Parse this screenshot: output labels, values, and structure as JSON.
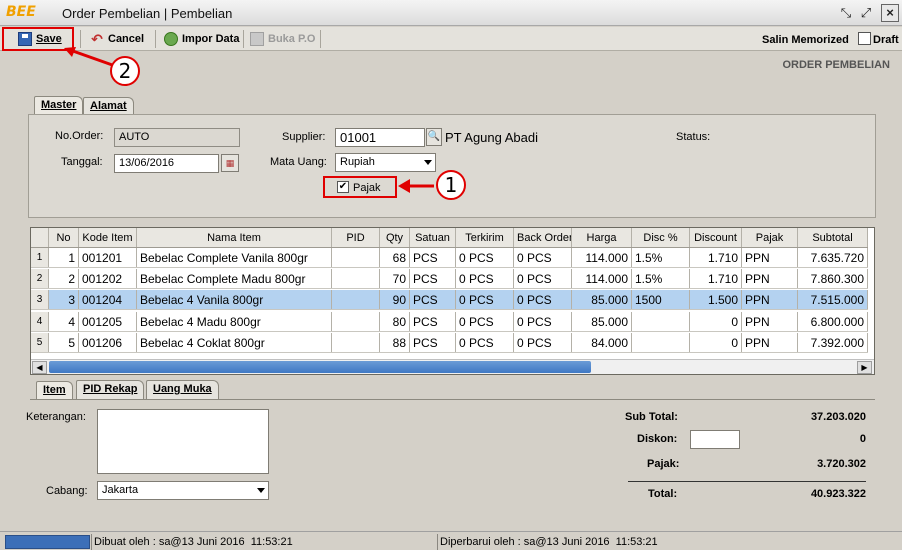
{
  "window": {
    "logo": "BEE",
    "title": "Order Pembelian | Pembelian"
  },
  "toolbar": {
    "save": "Save",
    "cancel": "Cancel",
    "impor": "Impor Data",
    "buka": "Buka P.O",
    "salin": "Salin Memorized",
    "draft": "Draft"
  },
  "callouts": {
    "one": "1",
    "two": "2"
  },
  "page_title": "ORDER PEMBELIAN",
  "tabs_top": {
    "master": "Master",
    "alamat": "Alamat"
  },
  "master": {
    "no_order_label": "No.Order:",
    "no_order_value": "AUTO",
    "tanggal_label": "Tanggal:",
    "tanggal_value": "13/06/2016",
    "supplier_label": "Supplier:",
    "supplier_code": "01001",
    "supplier_name": "PT Agung Abadi",
    "mata_uang_label": "Mata Uang:",
    "mata_uang_value": "Rupiah",
    "status_label": "Status:",
    "pajak_label": "Pajak",
    "pajak_checked": true
  },
  "grid": {
    "columns": [
      "No",
      "Kode Item",
      "Nama Item",
      "PID",
      "Qty",
      "Satuan",
      "Terkirim",
      "Back Order",
      "Harga",
      "Disc %",
      "Discount",
      "Pajak",
      "Subtotal"
    ],
    "rows": [
      {
        "rownum": "1",
        "no": "1",
        "kode": "001201",
        "nama": "Bebelac Complete Vanila 800gr",
        "pid": "",
        "qty": "68",
        "satuan": "PCS",
        "terkirim": "0 PCS",
        "backorder": "0 PCS",
        "harga": "114.000",
        "disc": "1.5%",
        "discount": "1.710",
        "pajak": "PPN",
        "subtotal": "7.635.720"
      },
      {
        "rownum": "2",
        "no": "2",
        "kode": "001202",
        "nama": "Bebelac Complete Madu 800gr",
        "pid": "",
        "qty": "70",
        "satuan": "PCS",
        "terkirim": "0 PCS",
        "backorder": "0 PCS",
        "harga": "114.000",
        "disc": "1.5%",
        "discount": "1.710",
        "pajak": "PPN",
        "subtotal": "7.860.300"
      },
      {
        "rownum": "3",
        "no": "3",
        "kode": "001204",
        "nama": "Bebelac 4 Vanila 800gr",
        "pid": "",
        "qty": "90",
        "satuan": "PCS",
        "terkirim": "0 PCS",
        "backorder": "0 PCS",
        "harga": "85.000",
        "disc": "1500",
        "discount": "1.500",
        "pajak": "PPN",
        "subtotal": "7.515.000"
      },
      {
        "rownum": "4",
        "no": "4",
        "kode": "001205",
        "nama": "Bebelac 4 Madu 800gr",
        "pid": "",
        "qty": "80",
        "satuan": "PCS",
        "terkirim": "0 PCS",
        "backorder": "0 PCS",
        "harga": "85.000",
        "disc": "",
        "discount": "0",
        "pajak": "PPN",
        "subtotal": "6.800.000"
      },
      {
        "rownum": "5",
        "no": "5",
        "kode": "001206",
        "nama": "Bebelac 4 Coklat 800gr",
        "pid": "",
        "qty": "88",
        "satuan": "PCS",
        "terkirim": "0 PCS",
        "backorder": "0 PCS",
        "harga": "84.000",
        "disc": "",
        "discount": "0",
        "pajak": "PPN",
        "subtotal": "7.392.000"
      }
    ]
  },
  "tabs_bottom": {
    "item": "Item",
    "pid_rekap": "PID Rekap",
    "uang_muka": "Uang Muka"
  },
  "footer": {
    "keterangan_label": "Keterangan:",
    "keterangan_value": "",
    "cabang_label": "Cabang:",
    "cabang_value": "Jakarta",
    "subtotal_label": "Sub Total:",
    "subtotal_value": "37.203.020",
    "diskon_label": "Diskon:",
    "diskon_input": "",
    "diskon_value": "0",
    "pajak_label": "Pajak:",
    "pajak_value": "3.720.302",
    "total_label": "Total:",
    "total_value": "40.923.322"
  },
  "status": {
    "dibuat": "Dibuat oleh : sa@13 Juni 2016  11:53:21",
    "diperbarui": "Diperbarui oleh : sa@13 Juni 2016  11:53:21"
  }
}
